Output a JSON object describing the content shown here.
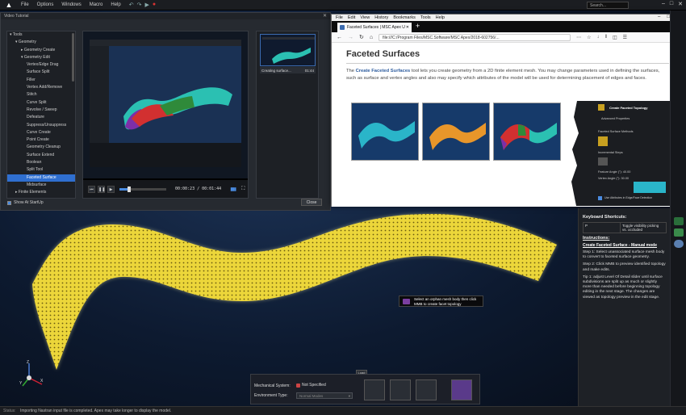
{
  "app": {
    "menu": [
      "File",
      "Options",
      "Windows",
      "Macro",
      "Help"
    ],
    "search_placeholder": "Search...",
    "window_controls": [
      "–",
      "□",
      "✕"
    ]
  },
  "tutorial": {
    "title": "Video Tutorial",
    "tree": [
      {
        "label": "▾ Tools",
        "indent": 0
      },
      {
        "label": "▾ Geometry",
        "indent": 1
      },
      {
        "label": "▸ Geometry Create",
        "indent": 2
      },
      {
        "label": "▾ Geometry Edit",
        "indent": 2
      },
      {
        "label": "Vertex/Edge Drag",
        "indent": 3
      },
      {
        "label": "Surface Split",
        "indent": 3
      },
      {
        "label": "Filler",
        "indent": 3
      },
      {
        "label": "Vertex Add/Remove",
        "indent": 3
      },
      {
        "label": "Stitch",
        "indent": 3
      },
      {
        "label": "Curve Split",
        "indent": 3
      },
      {
        "label": "Revolve / Sweep",
        "indent": 3
      },
      {
        "label": "Defeature",
        "indent": 3
      },
      {
        "label": "Suppress/Unsuppress",
        "indent": 3
      },
      {
        "label": "Curve Create",
        "indent": 3
      },
      {
        "label": "Point Create",
        "indent": 3
      },
      {
        "label": "Geometry Cleanup",
        "indent": 3
      },
      {
        "label": "Surface Extend",
        "indent": 3
      },
      {
        "label": "Boolean",
        "indent": 3
      },
      {
        "label": "Split Tool",
        "indent": 3
      },
      {
        "label": "Faceted Surface",
        "indent": 3,
        "selected": true
      },
      {
        "label": "Midsurface",
        "indent": 3
      },
      {
        "label": "▸ Finite Elements",
        "indent": 1
      }
    ],
    "time": "00:00:23 / 00:01:44",
    "progress": 0.2,
    "thumb_caption": "Creating surface...",
    "thumb_duration": "01:44",
    "show_at_startup": "Show At StartUp",
    "close_label": "Close"
  },
  "browser": {
    "menu": [
      "File",
      "Edit",
      "View",
      "History",
      "Bookmarks",
      "Tools",
      "Help"
    ],
    "tab_title": "Faceted Surfaces | MSC Apex U",
    "url": "file:///C:/Program Files/MSC.Software/MSC Apex/2018-602756/...",
    "page": {
      "title": "Faceted Surfaces",
      "para_prefix": "The ",
      "para_bold": "Create Faceted Surfaces",
      "para_rest": " tool lets you create geometry from a 2D finite element mesh. You may change parameters used in defining the surfaces, such as surface and vertex angles and also may specify which attributes of the model will be used for determining placement of edges and faces.",
      "panel": {
        "header": "Create Faceted Topology",
        "adv": "Advanced Properties",
        "methods": "Faceted Surface Methods",
        "steps": "Incremental Steps",
        "feature_angle_label": "Feature Angle (°):",
        "feature_angle": "40.00",
        "vertex_angle_label": "Vertex Angle (°):",
        "vertex_angle": "30.00",
        "checkbox": "Use Attributes in Edge/Face Detection"
      }
    }
  },
  "right_panel": {
    "kbd_title": "Keyboard Shortcuts:",
    "kbd_rows": [
      {
        "key": "P",
        "desc": "Toggle visibility picking vs. occluded"
      }
    ],
    "instructions_title": "Instructions:",
    "mode_link": "Create Faceted Surface - Manual mode",
    "step1": "Step 1: Select unassociated surface mesh body to convert to faceted surface geometry.",
    "step2": "Step 2: Click MMB to preview identified topology and make edits.",
    "tip": "Tip 1: adjust Level Of Detail slider until surface subdivisions are split up as much or slightly more than needed before beginning topology editing in the next stage. The changes are viewed as topology preview in the edit stage."
  },
  "tooltip": "Select an orphan mesh body then click MMB to create facet topology",
  "dock": {
    "mech_label": "Mechanical System:",
    "mech_value": "Not Specified",
    "env_label": "Environment Type:",
    "env_value": "Normal Modes",
    "tag": "Load"
  },
  "status": {
    "label": "Status:",
    "text": "Importing Nastran input file is completed. Apex may take longer to display the model."
  },
  "triad_labels": {
    "z": "Z",
    "x": "X",
    "y": "Y"
  }
}
